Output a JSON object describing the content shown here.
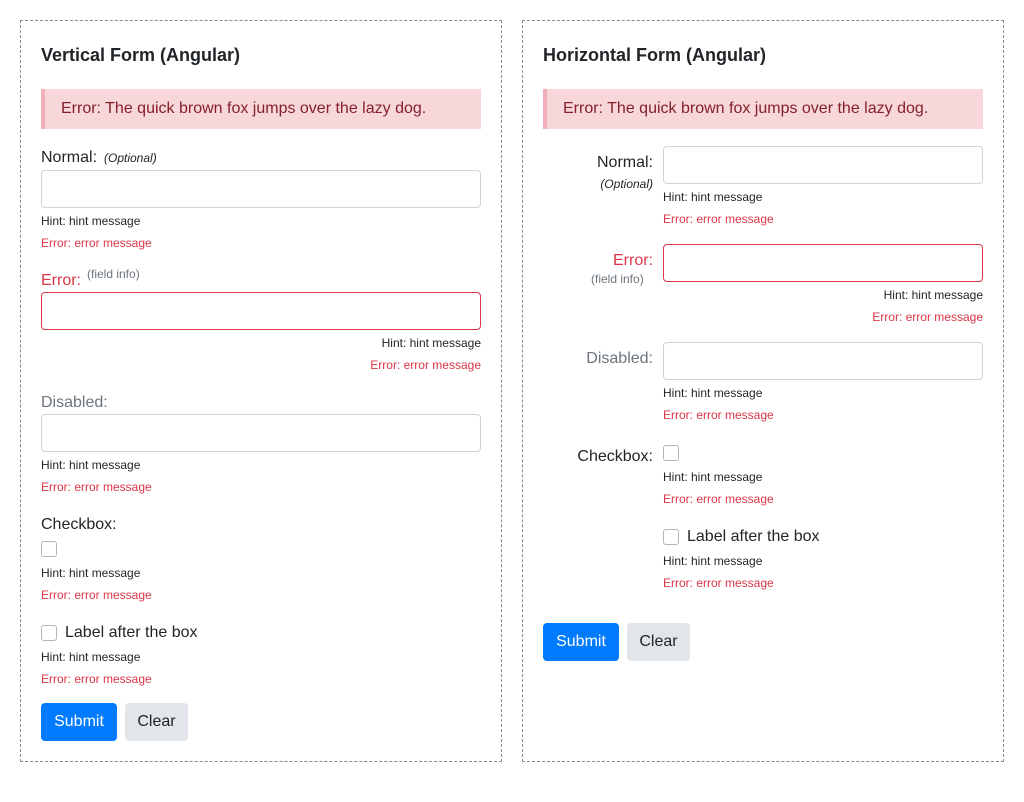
{
  "vertical": {
    "title": "Vertical Form (Angular)",
    "alert": "Error: The quick brown fox jumps over the lazy dog.",
    "normal": {
      "label": "Normal:",
      "optional": "(Optional)",
      "hint": "Hint: hint message",
      "error": "Error: error message"
    },
    "error_field": {
      "label": "Error:",
      "info": "(field info)",
      "hint": "Hint: hint message",
      "error": "Error: error message"
    },
    "disabled": {
      "label": "Disabled:",
      "hint": "Hint: hint message",
      "error": "Error: error message"
    },
    "checkbox": {
      "label": "Checkbox:",
      "hint": "Hint: hint message",
      "error": "Error: error message"
    },
    "checkbox_after": {
      "label": "Label after the box",
      "hint": "Hint: hint message",
      "error": "Error: error message"
    },
    "submit": "Submit",
    "clear": "Clear"
  },
  "horizontal": {
    "title": "Horizontal Form (Angular)",
    "alert": "Error: The quick brown fox jumps over the lazy dog.",
    "normal": {
      "label": "Normal:",
      "optional": "(Optional)",
      "hint": "Hint: hint message",
      "error": "Error: error message"
    },
    "error_field": {
      "label": "Error:",
      "info": "(field info)",
      "hint": "Hint: hint message",
      "error": "Error: error message"
    },
    "disabled": {
      "label": "Disabled:",
      "hint": "Hint: hint message",
      "error": "Error: error message"
    },
    "checkbox": {
      "label": "Checkbox:",
      "hint": "Hint: hint message",
      "error": "Error: error message"
    },
    "checkbox_after": {
      "label": "Label after the box",
      "hint": "Hint: hint message",
      "error": "Error: error message"
    },
    "submit": "Submit",
    "clear": "Clear"
  },
  "colors": {
    "primary": "#007bff",
    "danger": "#dc3545",
    "alert_bg": "#f8d7da",
    "muted": "#6c757d"
  }
}
